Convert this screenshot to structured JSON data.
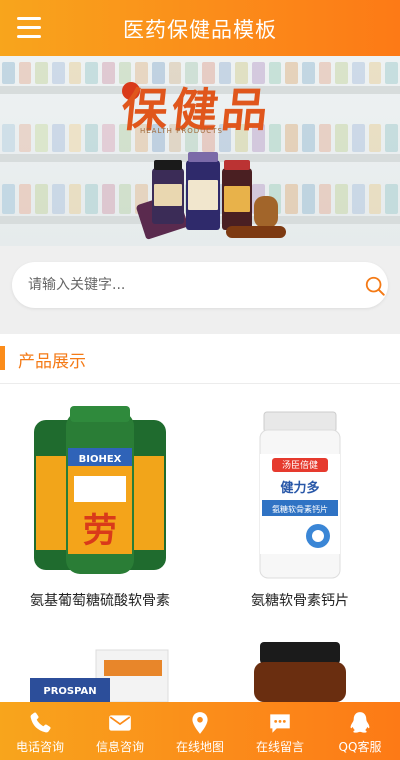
{
  "header": {
    "title": "医药保健品模板",
    "menu_icon": "hamburger-menu-icon"
  },
  "banner": {
    "headline": "保健品",
    "subtitle": "HEALTH PRODUCTS",
    "slides": 3,
    "active_slide": 1
  },
  "search": {
    "placeholder": "请输入关键字...",
    "value": "",
    "icon": "search-icon"
  },
  "products_section": {
    "title": "产品展示",
    "items": [
      {
        "name": "氨基葡萄糖硫酸软骨素",
        "image": "biohex-bottles"
      },
      {
        "name": "氨糖软骨素钙片",
        "image": "calcium-tablet-bottle"
      },
      {
        "name": "",
        "image": "prospan-box"
      },
      {
        "name": "",
        "image": "amber-bottle"
      }
    ]
  },
  "bottom_nav": [
    {
      "label": "电话咨询",
      "icon": "phone-icon"
    },
    {
      "label": "信息咨询",
      "icon": "mail-icon"
    },
    {
      "label": "在线地图",
      "icon": "map-pin-icon"
    },
    {
      "label": "在线留言",
      "icon": "chat-icon"
    },
    {
      "label": "QQ客服",
      "icon": "qq-penguin-icon"
    }
  ],
  "colors": {
    "accent": "#fb8c1a",
    "accent_light": "#f8a51c",
    "section_title": "#f47a16"
  }
}
